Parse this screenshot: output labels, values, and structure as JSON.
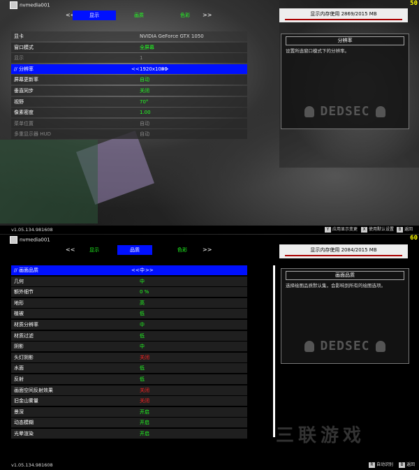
{
  "colors": {
    "accent_blue": "#0010ff",
    "value_green": "#22ff22",
    "value_red": "#ff2222",
    "fps_yellow": "#ffff00",
    "mem_bar": "#aa0000"
  },
  "top": {
    "user": "nvmedia001",
    "fps": "50",
    "tabs": [
      {
        "label": "显示",
        "active": true
      },
      {
        "label": "画质",
        "active": false
      },
      {
        "label": "色彩",
        "active": false
      }
    ],
    "header_row": {
      "label": "显卡",
      "value": "NVIDIA GeForce GTX 1050"
    },
    "rows": [
      {
        "label": "窗口模式",
        "value": "全屏幕",
        "state": "normal"
      },
      {
        "label": "显示",
        "value": "1",
        "state": "dim"
      },
      {
        "label": "//  分辨率",
        "value": "1920x1080",
        "state": "selected"
      },
      {
        "label": "屏幕更新率",
        "value": "自动",
        "state": "normal"
      },
      {
        "label": "垂直同步",
        "value": "关闭",
        "state": "normal"
      },
      {
        "label": "视野",
        "value": "70°",
        "state": "normal"
      },
      {
        "label": "像素密度",
        "value": "1.00",
        "state": "normal"
      },
      {
        "label": "菜单位置",
        "value": "自动",
        "state": "dim"
      },
      {
        "label": "多重显示器 HUD",
        "value": "自动",
        "state": "dim"
      }
    ],
    "memory": "显示内存使用 2869/2015 MB",
    "desc_title": "分辨率",
    "desc_body": "设置所选窗口模式下的分辨率。",
    "logo": "DEDSEC",
    "version": "v1.05.134.981608",
    "footer_buttons": [
      {
        "key": "Y",
        "label": "应用显示变更"
      },
      {
        "key": "X",
        "label": "使用默认设置"
      },
      {
        "key": "B",
        "label": "返回"
      }
    ]
  },
  "bottom": {
    "user": "nvmedia001",
    "fps": "60",
    "tabs": [
      {
        "label": "显示",
        "active": false
      },
      {
        "label": "品质",
        "active": true
      },
      {
        "label": "色彩",
        "active": false
      }
    ],
    "rows": [
      {
        "label": "//  画面品质",
        "value": "中",
        "state": "selected"
      },
      {
        "label": "几何",
        "value": "中",
        "state": "normal"
      },
      {
        "label": "额外细节",
        "value": "0 %",
        "state": "normal"
      },
      {
        "label": "地形",
        "value": "高",
        "state": "normal"
      },
      {
        "label": "植被",
        "value": "低",
        "state": "normal"
      },
      {
        "label": "材质分辨率",
        "value": "中",
        "state": "normal"
      },
      {
        "label": "材质过滤",
        "value": "低",
        "state": "normal"
      },
      {
        "label": "阴影",
        "value": "中",
        "state": "normal"
      },
      {
        "label": "头灯阴影",
        "value": "关闭",
        "state": "red"
      },
      {
        "label": "水面",
        "value": "低",
        "state": "normal"
      },
      {
        "label": "反射",
        "value": "低",
        "state": "normal"
      },
      {
        "label": "画面空间反射效果",
        "value": "关闭",
        "state": "red"
      },
      {
        "label": "旧金山雾量",
        "value": "关闭",
        "state": "red"
      },
      {
        "label": "景深",
        "value": "开启",
        "state": "normal"
      },
      {
        "label": "动态模糊",
        "value": "开启",
        "state": "normal"
      },
      {
        "label": "光晕渲染",
        "value": "开启",
        "state": "normal"
      }
    ],
    "memory": "显示内存使用 2084/2015 MB",
    "desc_title": "画面品质",
    "desc_body": "选择绘图品质默认集，会影响到所有的绘图选项。",
    "logo": "DEDSEC",
    "version": "v1.05.134.981608",
    "footer_buttons": [
      {
        "key": "R",
        "label": "自动识别"
      },
      {
        "key": "B",
        "label": "返回"
      }
    ],
    "watermark": "三联游戏"
  },
  "chevron_left": "<<",
  "chevron_right": ">>"
}
